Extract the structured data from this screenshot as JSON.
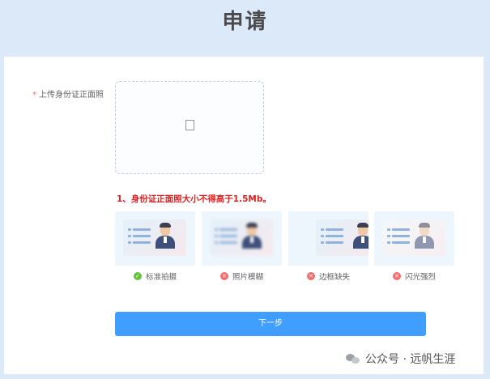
{
  "header": {
    "title": "申请"
  },
  "form": {
    "required_mark": "*",
    "upload_label": "上传身份证正面照",
    "uploader_icon": "image-placeholder-icon",
    "warning": "1、身份证正面照大小不得高于1.5Mb。",
    "next_button": "下一步"
  },
  "samples": [
    {
      "caption": "标准拍摄",
      "status": "ok",
      "status_icon": "check-icon"
    },
    {
      "caption": "照片模糊",
      "status": "bad",
      "status_icon": "cross-icon"
    },
    {
      "caption": "边框缺失",
      "status": "bad",
      "status_icon": "cross-icon"
    },
    {
      "caption": "闪光强烈",
      "status": "bad",
      "status_icon": "cross-icon"
    }
  ],
  "watermark": {
    "text": "公众号 · 远帆生涯"
  },
  "colors": {
    "primary": "#409eff",
    "warning": "#e02020",
    "ok": "#67c23a",
    "bad": "#f56c6c",
    "background": "#dce9f8"
  }
}
